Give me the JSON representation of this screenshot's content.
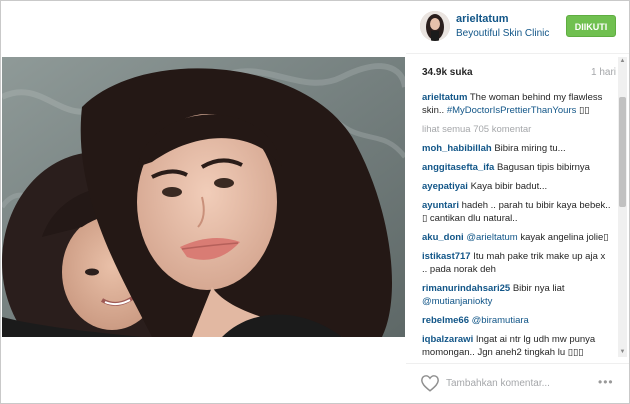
{
  "post": {
    "username": "arieltatum",
    "location": "Beyoutiful Skin Clinic",
    "follow_label": "DIIKUTI",
    "likes": "34.9k suka",
    "time": "1 hari",
    "caption_user": "arieltatum",
    "caption_text": "The woman behind my flawless skin..",
    "caption_tag": "#MyDoctorIsPrettierThanYours",
    "caption_tail": "▯▯",
    "view_all": "lihat semua 705 komentar"
  },
  "comments": [
    {
      "user": "moh_habibillah",
      "text": "Bibira miring tu...",
      "tag": ""
    },
    {
      "user": "anggitasefta_ifa",
      "text": "Bagusan tipis bibirnya",
      "tag": ""
    },
    {
      "user": "ayepatiyai",
      "text": "Kaya bibir badut...",
      "tag": ""
    },
    {
      "user": "ayuntari",
      "text": "hadeh .. parah tu bibir kaya bebek.. ▯ cantikan dlu natural..",
      "tag": ""
    },
    {
      "user": "aku_doni",
      "text": "kayak angelina jolie▯",
      "tag": "@arieltatum"
    },
    {
      "user": "istikast717",
      "text": "Itu mah pake trik make up aja x .. pada norak deh",
      "tag": ""
    },
    {
      "user": "rimanurindahsari25",
      "text": "Bibir nya liat",
      "tag": "@mutianjaniokty"
    },
    {
      "user": "rebelme66",
      "text": "",
      "tag": "@biramutiara"
    },
    {
      "user": "iqbalzarawi",
      "text": "Ingat ai ntr lg udh mw punya momongan.. Jgn aneh2 tingkah lu ▯▯▯",
      "tag": ""
    }
  ],
  "footer": {
    "comment_placeholder": "Tambahkan komentar...",
    "more_label": "•••"
  },
  "colors": {
    "link": "#125688",
    "follow_green": "#70c050",
    "muted": "#a5a7aa"
  },
  "icons": {
    "like": "heart-icon",
    "options": "more-options-icon"
  }
}
